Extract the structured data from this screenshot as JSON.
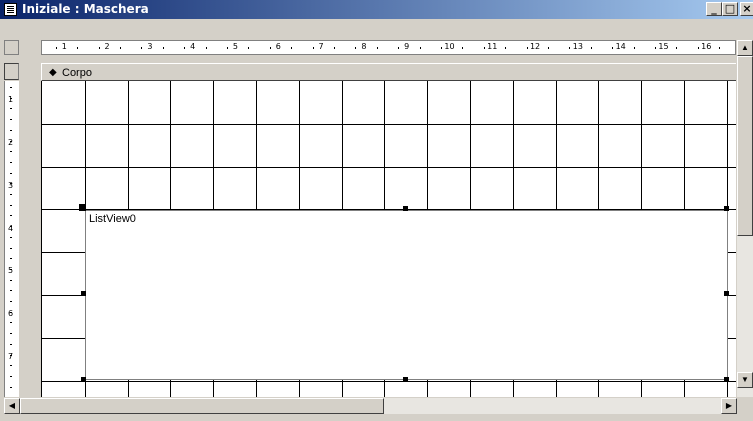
{
  "window": {
    "title": "Iniziale : Maschera",
    "minimize_label": "_",
    "maximize_label": "□",
    "close_label": "×"
  },
  "ruler": {
    "horizontal_labels": [
      "1",
      "2",
      "3",
      "4",
      "5",
      "6",
      "7",
      "8",
      "9",
      "10",
      "11",
      "12",
      "13",
      "14",
      "15",
      "16"
    ],
    "vertical_labels": [
      "1",
      "2",
      "3",
      "4",
      "5",
      "6",
      "7"
    ]
  },
  "section": {
    "arrow": "◆",
    "label": "Corpo"
  },
  "listview": {
    "label": "ListView0"
  },
  "scroll": {
    "up_arrow": "▲",
    "down_arrow": "▼",
    "left_arrow": "◀",
    "right_arrow": "▶"
  }
}
